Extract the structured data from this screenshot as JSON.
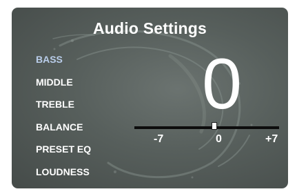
{
  "window": {
    "title": "Audio Settings"
  },
  "menu": {
    "items": [
      {
        "label": "BASS",
        "active": true
      },
      {
        "label": "MIDDLE",
        "active": false
      },
      {
        "label": "TREBLE",
        "active": false
      },
      {
        "label": "BALANCE",
        "active": false
      },
      {
        "label": "PRESET EQ",
        "active": false
      },
      {
        "label": "LOUDNESS",
        "active": false
      }
    ]
  },
  "setting": {
    "current_value": "0",
    "slider": {
      "min_label": "-7",
      "mid_label": "0",
      "max_label": "+7",
      "min": -7,
      "max": 7,
      "value": 0
    }
  },
  "colors": {
    "background": "#575f5c",
    "text": "#ffffff",
    "active_item": "#b9cdea",
    "track": "#0d0d0d"
  },
  "icons": {
    "background": "water-splash-icon"
  }
}
